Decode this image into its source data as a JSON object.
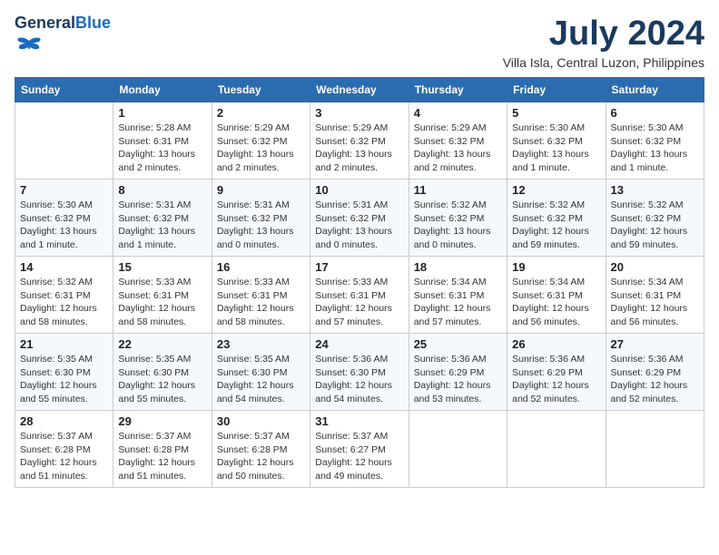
{
  "header": {
    "logo_line1": "General",
    "logo_line2": "Blue",
    "month_year": "July 2024",
    "location": "Villa Isla, Central Luzon, Philippines"
  },
  "days_of_week": [
    "Sunday",
    "Monday",
    "Tuesday",
    "Wednesday",
    "Thursday",
    "Friday",
    "Saturday"
  ],
  "weeks": [
    [
      {
        "day": "",
        "text": ""
      },
      {
        "day": "1",
        "text": "Sunrise: 5:28 AM\nSunset: 6:31 PM\nDaylight: 13 hours\nand 2 minutes."
      },
      {
        "day": "2",
        "text": "Sunrise: 5:29 AM\nSunset: 6:32 PM\nDaylight: 13 hours\nand 2 minutes."
      },
      {
        "day": "3",
        "text": "Sunrise: 5:29 AM\nSunset: 6:32 PM\nDaylight: 13 hours\nand 2 minutes."
      },
      {
        "day": "4",
        "text": "Sunrise: 5:29 AM\nSunset: 6:32 PM\nDaylight: 13 hours\nand 2 minutes."
      },
      {
        "day": "5",
        "text": "Sunrise: 5:30 AM\nSunset: 6:32 PM\nDaylight: 13 hours\nand 1 minute."
      },
      {
        "day": "6",
        "text": "Sunrise: 5:30 AM\nSunset: 6:32 PM\nDaylight: 13 hours\nand 1 minute."
      }
    ],
    [
      {
        "day": "7",
        "text": "Sunrise: 5:30 AM\nSunset: 6:32 PM\nDaylight: 13 hours\nand 1 minute."
      },
      {
        "day": "8",
        "text": "Sunrise: 5:31 AM\nSunset: 6:32 PM\nDaylight: 13 hours\nand 1 minute."
      },
      {
        "day": "9",
        "text": "Sunrise: 5:31 AM\nSunset: 6:32 PM\nDaylight: 13 hours\nand 0 minutes."
      },
      {
        "day": "10",
        "text": "Sunrise: 5:31 AM\nSunset: 6:32 PM\nDaylight: 13 hours\nand 0 minutes."
      },
      {
        "day": "11",
        "text": "Sunrise: 5:32 AM\nSunset: 6:32 PM\nDaylight: 13 hours\nand 0 minutes."
      },
      {
        "day": "12",
        "text": "Sunrise: 5:32 AM\nSunset: 6:32 PM\nDaylight: 12 hours\nand 59 minutes."
      },
      {
        "day": "13",
        "text": "Sunrise: 5:32 AM\nSunset: 6:32 PM\nDaylight: 12 hours\nand 59 minutes."
      }
    ],
    [
      {
        "day": "14",
        "text": "Sunrise: 5:32 AM\nSunset: 6:31 PM\nDaylight: 12 hours\nand 58 minutes."
      },
      {
        "day": "15",
        "text": "Sunrise: 5:33 AM\nSunset: 6:31 PM\nDaylight: 12 hours\nand 58 minutes."
      },
      {
        "day": "16",
        "text": "Sunrise: 5:33 AM\nSunset: 6:31 PM\nDaylight: 12 hours\nand 58 minutes."
      },
      {
        "day": "17",
        "text": "Sunrise: 5:33 AM\nSunset: 6:31 PM\nDaylight: 12 hours\nand 57 minutes."
      },
      {
        "day": "18",
        "text": "Sunrise: 5:34 AM\nSunset: 6:31 PM\nDaylight: 12 hours\nand 57 minutes."
      },
      {
        "day": "19",
        "text": "Sunrise: 5:34 AM\nSunset: 6:31 PM\nDaylight: 12 hours\nand 56 minutes."
      },
      {
        "day": "20",
        "text": "Sunrise: 5:34 AM\nSunset: 6:31 PM\nDaylight: 12 hours\nand 56 minutes."
      }
    ],
    [
      {
        "day": "21",
        "text": "Sunrise: 5:35 AM\nSunset: 6:30 PM\nDaylight: 12 hours\nand 55 minutes."
      },
      {
        "day": "22",
        "text": "Sunrise: 5:35 AM\nSunset: 6:30 PM\nDaylight: 12 hours\nand 55 minutes."
      },
      {
        "day": "23",
        "text": "Sunrise: 5:35 AM\nSunset: 6:30 PM\nDaylight: 12 hours\nand 54 minutes."
      },
      {
        "day": "24",
        "text": "Sunrise: 5:36 AM\nSunset: 6:30 PM\nDaylight: 12 hours\nand 54 minutes."
      },
      {
        "day": "25",
        "text": "Sunrise: 5:36 AM\nSunset: 6:29 PM\nDaylight: 12 hours\nand 53 minutes."
      },
      {
        "day": "26",
        "text": "Sunrise: 5:36 AM\nSunset: 6:29 PM\nDaylight: 12 hours\nand 52 minutes."
      },
      {
        "day": "27",
        "text": "Sunrise: 5:36 AM\nSunset: 6:29 PM\nDaylight: 12 hours\nand 52 minutes."
      }
    ],
    [
      {
        "day": "28",
        "text": "Sunrise: 5:37 AM\nSunset: 6:28 PM\nDaylight: 12 hours\nand 51 minutes."
      },
      {
        "day": "29",
        "text": "Sunrise: 5:37 AM\nSunset: 6:28 PM\nDaylight: 12 hours\nand 51 minutes."
      },
      {
        "day": "30",
        "text": "Sunrise: 5:37 AM\nSunset: 6:28 PM\nDaylight: 12 hours\nand 50 minutes."
      },
      {
        "day": "31",
        "text": "Sunrise: 5:37 AM\nSunset: 6:27 PM\nDaylight: 12 hours\nand 49 minutes."
      },
      {
        "day": "",
        "text": ""
      },
      {
        "day": "",
        "text": ""
      },
      {
        "day": "",
        "text": ""
      }
    ]
  ]
}
